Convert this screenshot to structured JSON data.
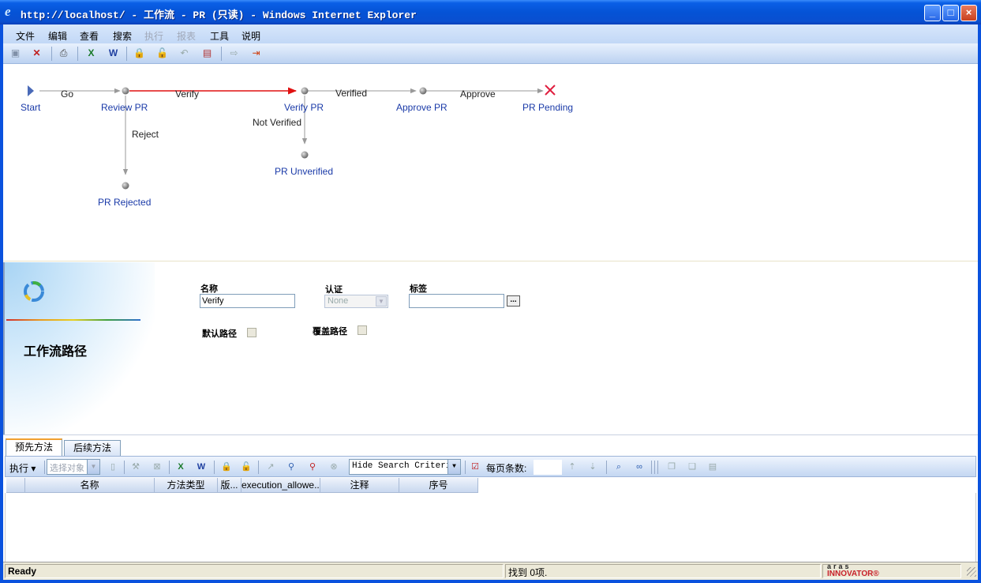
{
  "window": {
    "title": "http://localhost/ - 工作流 - PR (只读) - Windows Internet Explorer",
    "minimize": "_",
    "maximize": "□",
    "close": "×"
  },
  "menu": [
    {
      "label": "文件",
      "enabled": true
    },
    {
      "label": "编辑",
      "enabled": true
    },
    {
      "label": "查看",
      "enabled": true
    },
    {
      "label": "搜索",
      "enabled": true
    },
    {
      "label": "执行",
      "enabled": false
    },
    {
      "label": "报表",
      "enabled": false
    },
    {
      "label": "工具",
      "enabled": true
    },
    {
      "label": "说明",
      "enabled": true
    }
  ],
  "toolbar_icons": [
    "save-icon",
    "close-item-icon",
    "print-icon",
    "excel-icon",
    "word-icon",
    "lock-icon",
    "unlock-icon",
    "undo-icon",
    "delete-icon",
    "promote-icon",
    "exit-icon"
  ],
  "workflow": {
    "nodes": {
      "start": "Start",
      "review_pr": "Review PR",
      "verify_pr": "Verify PR",
      "approve_pr": "Approve PR",
      "pr_pending": "PR Pending",
      "pr_unverified": "PR Unverified",
      "pr_rejected": "PR Rejected"
    },
    "paths": {
      "go": "Go",
      "verify": "Verify",
      "verified": "Verified",
      "approve": "Approve",
      "reject": "Reject",
      "not_verified": "Not Verified"
    },
    "selected_path": "Verify",
    "selected_color": "#e01010"
  },
  "properties": {
    "section_title": "工作流路径",
    "name_label": "名称",
    "name_value": "Verify",
    "auth_label": "认证",
    "auth_value": "None",
    "tag_label": "标签",
    "tag_value": "",
    "ellipsis": "...",
    "default_path_label": "默认路径",
    "default_path_checked": false,
    "override_path_label": "覆盖路径",
    "override_path_checked": false
  },
  "tabs": [
    {
      "label": "预先方法",
      "active": true
    },
    {
      "label": "后续方法",
      "active": false
    }
  ],
  "grid_toolbar": {
    "execute": "执行 ▾",
    "select_placeholder": "选择对象",
    "search_mode": "Hide Search Criteria",
    "page_size_label": "每页条数:"
  },
  "grid_columns": [
    "名称",
    "方法类型",
    "版...",
    "execution_allowe...",
    "注释",
    "序号"
  ],
  "status": {
    "left": "Ready",
    "middle": "找到 0项.",
    "brand_top": "aras",
    "brand_bottom": "INNOVATOR®"
  }
}
